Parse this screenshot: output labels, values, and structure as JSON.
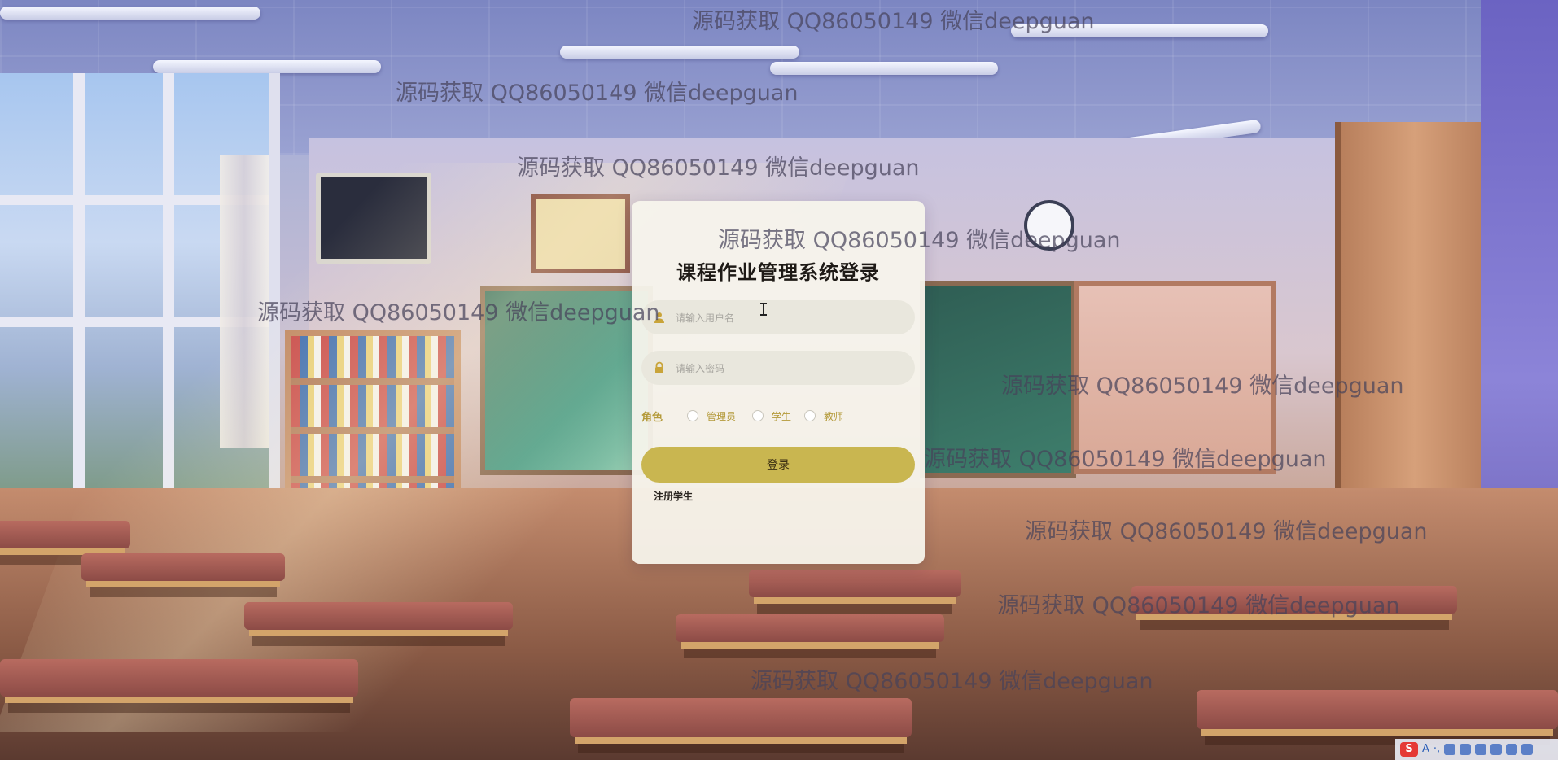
{
  "login": {
    "title": "课程作业管理系统登录",
    "username_placeholder": "请输入用户名",
    "password_placeholder": "请输入密码",
    "role_label": "角色",
    "roles": [
      "管理员",
      "学生",
      "教师"
    ],
    "login_button": "登录",
    "register_link": "注册学生"
  },
  "watermark_text": "源码获取 QQ86050149 微信deepguan",
  "tray": {
    "ime_logo": "S",
    "ime_mode": "A",
    "ime_punct": "·,"
  },
  "icons": {
    "username_field": "user-icon",
    "password_field": "lock-icon"
  },
  "colors": {
    "accent_gold": "#c9b650",
    "role_text": "#b49a3a",
    "card_bg": "#f6f4ec",
    "title": "#1e1a16"
  }
}
